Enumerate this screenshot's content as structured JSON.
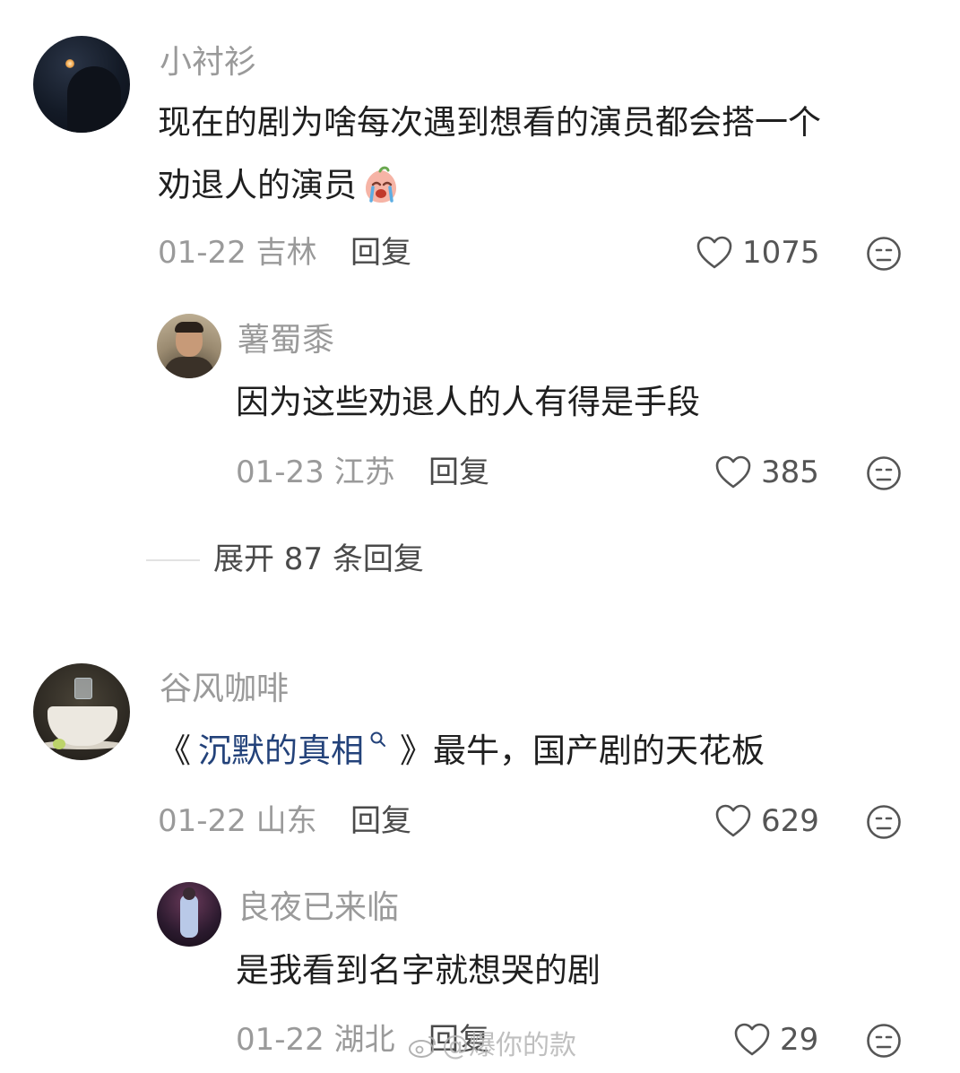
{
  "comments": [
    {
      "username": "小衬衫",
      "text_line1": "现在的剧为啥每次遇到想看的演员都会搭一个",
      "text_line2": "劝退人的演员",
      "date": "01-22",
      "location": "吉林",
      "reply_label": "回复",
      "likes": "1075",
      "avatar_icon": "night-silhouette-avatar",
      "emoji_icon": "crying-peach-emoji",
      "replies": [
        {
          "username": "薯蜀黍",
          "text": "因为这些劝退人的人有得是手段",
          "date": "01-23",
          "location": "江苏",
          "reply_label": "回复",
          "likes": "385",
          "avatar_icon": "man-portrait-avatar"
        }
      ],
      "expand_label": "展开 87 条回复"
    },
    {
      "username": "谷风咖啡",
      "text_open": "《",
      "text_link": "沉默的真相",
      "text_link_icon": "search-icon",
      "text_rest": "》最牛，国产剧的天花板",
      "date": "01-22",
      "location": "山东",
      "reply_label": "回复",
      "likes": "629",
      "avatar_icon": "coffee-cup-avatar",
      "replies": [
        {
          "username": "良夜已来临",
          "text": "是我看到名字就想哭的剧",
          "date": "01-22",
          "location": "湖北",
          "reply_label": "回复",
          "likes": "29",
          "avatar_icon": "stage-performer-avatar"
        }
      ]
    }
  ],
  "watermark": "@爆你的款",
  "colors": {
    "link": "#23427a",
    "meta": "#9a9a9a",
    "text": "#1f1f1f"
  }
}
